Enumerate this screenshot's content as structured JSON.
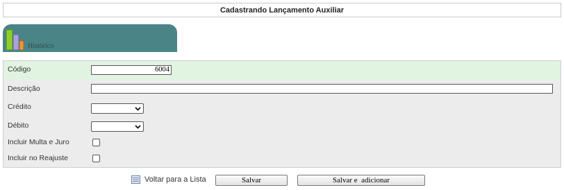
{
  "page": {
    "title": "Cadastrando Lançamento Auxiliar"
  },
  "tab": {
    "label": "Histórico",
    "icon": "bar-chart-icon"
  },
  "form": {
    "codigo": {
      "label": "Código",
      "value": "6004"
    },
    "descricao": {
      "label": "Descrição",
      "value": ""
    },
    "credito": {
      "label": "Crédito",
      "value": ""
    },
    "debito": {
      "label": "Débito",
      "value": ""
    },
    "multa_juro": {
      "label": "Incluir Multa e Juro",
      "checked": false
    },
    "reajuste": {
      "label": "Incluir no Reajuste",
      "checked": false
    }
  },
  "actions": {
    "voltar": "Voltar para a Lista",
    "salvar": "Salvar",
    "salvar_adicionar": "Salvar e  adicionar"
  },
  "colors": {
    "tab": "#4a8486",
    "highlight_row": "#e1f3e1",
    "form_bg": "#ececec"
  }
}
